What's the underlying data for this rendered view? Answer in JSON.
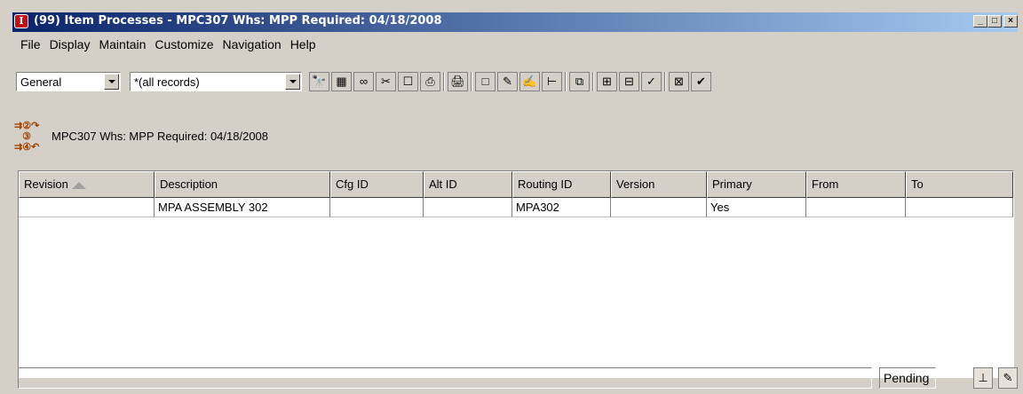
{
  "window": {
    "title": "(99) Item Processes - MPC307   Whs: MPP   Required: 04/18/2008",
    "controls": {
      "minimize": "_",
      "maximize": "□",
      "close": "×"
    }
  },
  "menu": [
    "File",
    "Display",
    "Maintain",
    "Customize",
    "Navigation",
    "Help"
  ],
  "toolbar": {
    "view_combo": "General",
    "filter_combo": "*(all records)",
    "buttons": [
      {
        "name": "find-icon",
        "glyph": "🔭"
      },
      {
        "name": "zoom-record-icon",
        "glyph": "▦"
      },
      {
        "name": "glasses-icon",
        "glyph": "∞"
      },
      {
        "name": "tools-icon",
        "glyph": "✂"
      },
      {
        "name": "note-icon",
        "glyph": "☐"
      },
      {
        "name": "print-setup-icon",
        "glyph": "⎙"
      },
      {
        "name": "printer-icon",
        "glyph": "🖨"
      },
      {
        "name": "new-record-icon",
        "glyph": "□"
      },
      {
        "name": "edit-pencil-icon",
        "glyph": "✎"
      },
      {
        "name": "edit-lines-icon",
        "glyph": "✍"
      },
      {
        "name": "hierarchy-icon",
        "glyph": "⊢"
      },
      {
        "name": "copy-icon",
        "glyph": "⧉"
      },
      {
        "name": "tree-expand-icon",
        "glyph": "⊞"
      },
      {
        "name": "tree-collapse-icon",
        "glyph": "⊟"
      },
      {
        "name": "checkmark-down-icon",
        "glyph": "✓"
      },
      {
        "name": "structure-icon",
        "glyph": "⊠"
      },
      {
        "name": "check-list-icon",
        "glyph": "✔"
      }
    ]
  },
  "header": {
    "text": "MPC307   Whs: MPP   Required: 04/18/2008"
  },
  "grid": {
    "columns": [
      "Revision",
      "Description",
      "Cfg ID",
      "Alt ID",
      "Routing ID",
      "Version",
      "Primary",
      "From",
      "To"
    ],
    "rows": [
      [
        "",
        "MPA ASSEMBLY 302",
        "",
        "",
        "MPA302",
        "",
        "Yes",
        "",
        ""
      ]
    ]
  },
  "status": {
    "pending": "Pending"
  }
}
